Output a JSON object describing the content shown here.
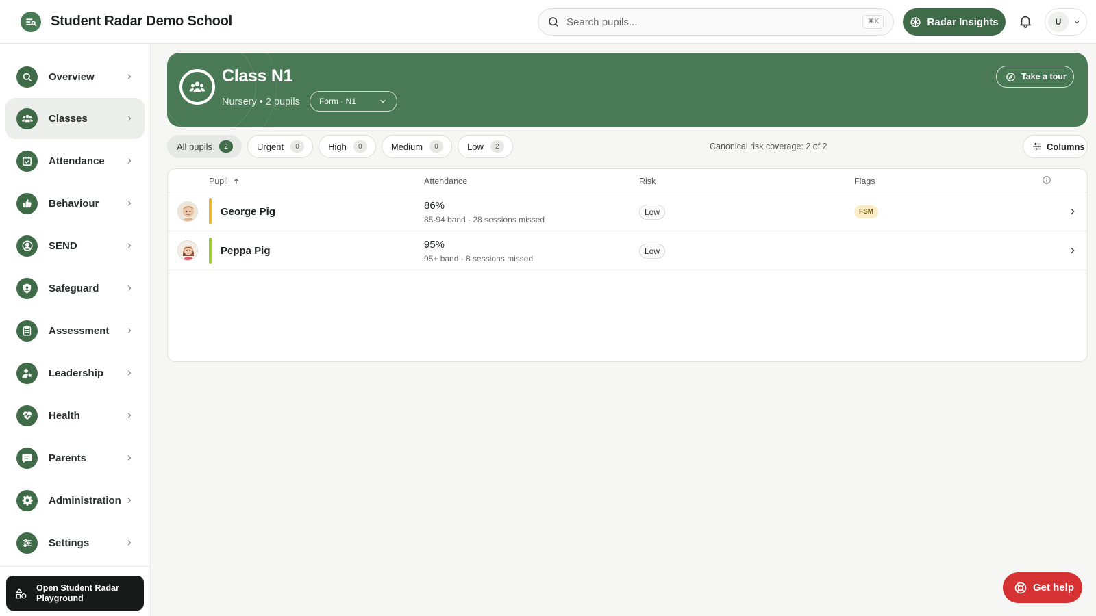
{
  "app": {
    "school_name": "Student Radar Demo School"
  },
  "search": {
    "placeholder": "Search pupils...",
    "shortcut": "⌘K"
  },
  "header": {
    "insights_label": "Radar Insights",
    "user_initial": "U"
  },
  "sidebar": {
    "items": [
      {
        "label": "Overview",
        "icon": "search-icon"
      },
      {
        "label": "Classes",
        "icon": "people-icon",
        "active": true
      },
      {
        "label": "Attendance",
        "icon": "calendar-check-icon"
      },
      {
        "label": "Behaviour",
        "icon": "thumbs-up-icon"
      },
      {
        "label": "SEND",
        "icon": "person-circle-icon"
      },
      {
        "label": "Safeguard",
        "icon": "shield-user-icon"
      },
      {
        "label": "Assessment",
        "icon": "clipboard-list-icon"
      },
      {
        "label": "Leadership",
        "icon": "user-star-icon"
      },
      {
        "label": "Health",
        "icon": "heart-pulse-icon"
      },
      {
        "label": "Parents",
        "icon": "chat-bubble-icon"
      },
      {
        "label": "Administration",
        "icon": "gear-icon"
      },
      {
        "label": "Settings",
        "icon": "sliders-icon"
      }
    ],
    "playground_label": "Open Student Radar Playground"
  },
  "class": {
    "title": "Class N1",
    "subtitle": "Nursery • 2 pupils",
    "form_select": "Form · N1",
    "tour_label": "Take a tour"
  },
  "filters": [
    {
      "label": "All pupils",
      "count": "2",
      "active": true
    },
    {
      "label": "Urgent",
      "count": "0"
    },
    {
      "label": "High",
      "count": "0"
    },
    {
      "label": "Medium",
      "count": "0"
    },
    {
      "label": "Low",
      "count": "2"
    }
  ],
  "coverage": "Canonical risk coverage: 2 of 2",
  "columns_label": "Columns",
  "table": {
    "headers": {
      "pupil": "Pupil",
      "attendance": "Attendance",
      "risk": "Risk",
      "flags": "Flags"
    },
    "rows": [
      {
        "name": "George Pig",
        "attendance": "86%",
        "attendance_detail": "85-94 band · 28 sessions missed",
        "risk": "Low",
        "flag": "FSM",
        "bar_color": "#e8b43a"
      },
      {
        "name": "Peppa Pig",
        "attendance": "95%",
        "attendance_detail": "95+ band · 8 sessions missed",
        "risk": "Low",
        "flag": "",
        "bar_color": "#9fcf3d"
      }
    ]
  },
  "help_label": "Get help"
}
